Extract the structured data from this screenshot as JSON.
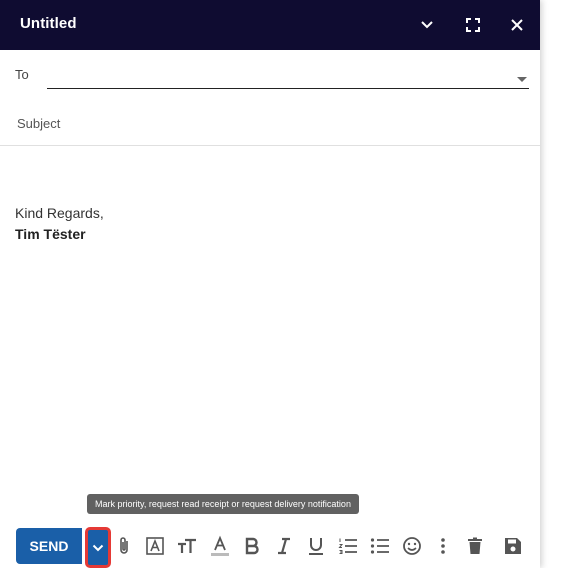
{
  "window": {
    "title": "Untitled"
  },
  "to": {
    "label": "To",
    "value": ""
  },
  "subject": {
    "placeholder": "Subject",
    "value": ""
  },
  "signature": {
    "line1": "Kind Regards,",
    "line2": "Tim Tëster"
  },
  "tooltip": {
    "text": "Mark priority, request read receipt or request delivery notification"
  },
  "toolbar": {
    "send_label": "SEND",
    "icons": [
      "chevron-down-icon",
      "paperclip-icon",
      "text-box-icon",
      "text-size-icon",
      "font-color-icon",
      "bold-icon",
      "italic-icon",
      "underline-icon",
      "numbered-list-icon",
      "bulleted-list-icon",
      "emoji-icon",
      "more-vertical-icon",
      "trash-icon",
      "save-icon"
    ]
  },
  "colors": {
    "titlebar": "#0f0c31",
    "send": "#1a5fa8",
    "highlight": "#e53935",
    "icon": "#555555"
  }
}
